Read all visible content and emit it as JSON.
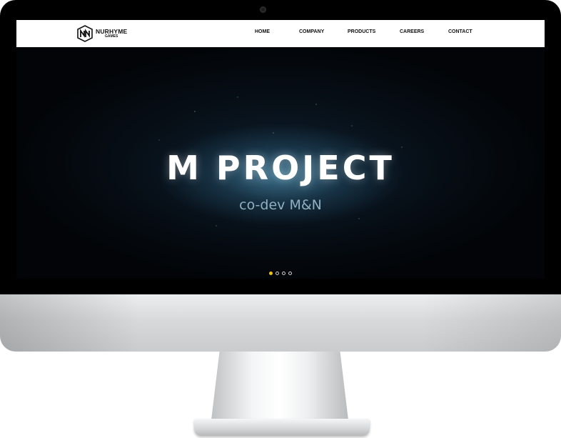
{
  "brand": {
    "name": "NURHYME",
    "sub": "GAMES"
  },
  "nav": {
    "items": [
      {
        "label": "HOME"
      },
      {
        "label": "COMPANY"
      },
      {
        "label": "PRODUCTS"
      },
      {
        "label": "CAREERS"
      },
      {
        "label": "CONTACT"
      }
    ]
  },
  "hero": {
    "title": "M PROJECT",
    "subtitle": "co-dev M&N",
    "slides_total": 4,
    "active_slide": 1,
    "active_dot_color": "#f2c20a"
  },
  "icons": [
    "nurhyme-logo-icon",
    "slide-dot-icon",
    "webcam-icon"
  ]
}
